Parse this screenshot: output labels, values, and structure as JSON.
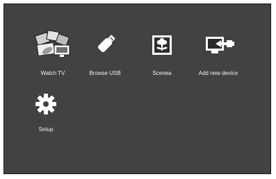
{
  "menu": {
    "items": [
      {
        "id": "watch-tv",
        "label": "Watch TV",
        "icon": "tv-collage-icon"
      },
      {
        "id": "browse-usb",
        "label": "Browse USB",
        "icon": "usb-drive-icon"
      },
      {
        "id": "scenea",
        "label": "Scenea",
        "icon": "flower-picture-icon"
      },
      {
        "id": "add-new-device",
        "label": "Add new device",
        "icon": "add-device-icon"
      },
      {
        "id": "setup",
        "label": "Setup",
        "icon": "gear-icon"
      }
    ]
  },
  "colors": {
    "background": "#424242",
    "text": "#f2f2f2",
    "icon": "#ffffff"
  }
}
